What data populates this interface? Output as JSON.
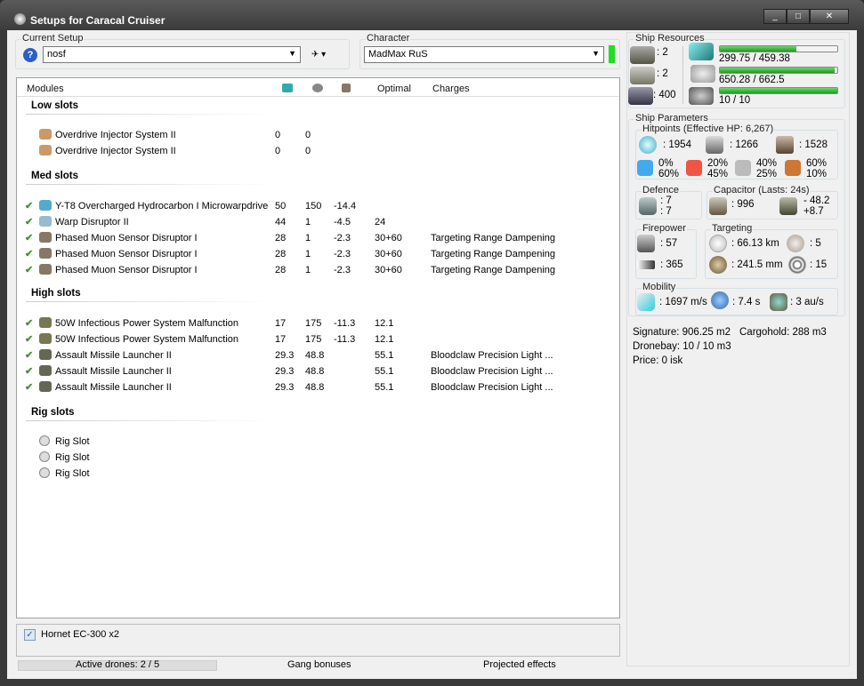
{
  "window": {
    "title": "Setups for Caracal Cruiser"
  },
  "current_setup": {
    "label": "Current Setup",
    "value": "nosf"
  },
  "character": {
    "label": "Character",
    "value": "MadMax RuS",
    "status_color": "#22dd22"
  },
  "table": {
    "headers": {
      "modules": "Modules",
      "optimal": "Optimal",
      "charges": "Charges"
    },
    "sections": [
      {
        "title": "Low slots",
        "rows": [
          {
            "name": "Overdrive Injector System II",
            "c1": "0",
            "c2": "0",
            "c3": "",
            "optimal": "",
            "charges": "",
            "active": false,
            "icon": "overdrive-icon"
          },
          {
            "name": "Overdrive Injector System II",
            "c1": "0",
            "c2": "0",
            "c3": "",
            "optimal": "",
            "charges": "",
            "active": false,
            "icon": "overdrive-icon"
          }
        ]
      },
      {
        "title": "Med slots",
        "rows": [
          {
            "name": "Y-T8 Overcharged Hydrocarbon I Microwarpdrive",
            "c1": "50",
            "c2": "150",
            "c3": "-14.4",
            "optimal": "",
            "charges": "",
            "active": true,
            "icon": "microwarpdrive-icon"
          },
          {
            "name": "Warp Disruptor II",
            "c1": "44",
            "c2": "1",
            "c3": "-4.5",
            "optimal": "24",
            "charges": "",
            "active": true,
            "icon": "warp-disruptor-icon"
          },
          {
            "name": "Phased Muon Sensor Disruptor I",
            "c1": "28",
            "c2": "1",
            "c3": "-2.3",
            "optimal": "30+60",
            "charges": "Targeting Range Dampening",
            "active": true,
            "icon": "sensor-disruptor-icon"
          },
          {
            "name": "Phased Muon Sensor Disruptor I",
            "c1": "28",
            "c2": "1",
            "c3": "-2.3",
            "optimal": "30+60",
            "charges": "Targeting Range Dampening",
            "active": true,
            "icon": "sensor-disruptor-icon"
          },
          {
            "name": "Phased Muon Sensor Disruptor I",
            "c1": "28",
            "c2": "1",
            "c3": "-2.3",
            "optimal": "30+60",
            "charges": "Targeting Range Dampening",
            "active": true,
            "icon": "sensor-disruptor-icon"
          }
        ]
      },
      {
        "title": "High slots",
        "rows": [
          {
            "name": "50W Infectious Power System Malfunction",
            "c1": "17",
            "c2": "175",
            "c3": "-11.3",
            "optimal": "12.1",
            "charges": "",
            "active": true,
            "icon": "energy-vampire-icon"
          },
          {
            "name": "50W Infectious Power System Malfunction",
            "c1": "17",
            "c2": "175",
            "c3": "-11.3",
            "optimal": "12.1",
            "charges": "",
            "active": true,
            "icon": "energy-vampire-icon"
          },
          {
            "name": "Assault Missile Launcher II",
            "c1": "29.3",
            "c2": "48.8",
            "c3": "",
            "optimal": "55.1",
            "charges": "Bloodclaw Precision Light ...",
            "active": true,
            "icon": "missile-launcher-icon"
          },
          {
            "name": "Assault Missile Launcher II",
            "c1": "29.3",
            "c2": "48.8",
            "c3": "",
            "optimal": "55.1",
            "charges": "Bloodclaw Precision Light ...",
            "active": true,
            "icon": "missile-launcher-icon"
          },
          {
            "name": "Assault Missile Launcher II",
            "c1": "29.3",
            "c2": "48.8",
            "c3": "",
            "optimal": "55.1",
            "charges": "Bloodclaw Precision Light ...",
            "active": true,
            "icon": "missile-launcher-icon"
          }
        ]
      },
      {
        "title": "Rig slots",
        "rows": [
          {
            "name": "Rig Slot",
            "c1": "",
            "c2": "",
            "c3": "",
            "optimal": "",
            "charges": "",
            "active": false,
            "icon": "empty-slot-icon"
          },
          {
            "name": "Rig Slot",
            "c1": "",
            "c2": "",
            "c3": "",
            "optimal": "",
            "charges": "",
            "active": false,
            "icon": "empty-slot-icon"
          },
          {
            "name": "Rig Slot",
            "c1": "",
            "c2": "",
            "c3": "",
            "optimal": "",
            "charges": "",
            "active": false,
            "icon": "empty-slot-icon"
          }
        ]
      }
    ]
  },
  "drones": {
    "item": "Hornet EC-300 x2",
    "checked": true
  },
  "status": {
    "active_drones": "Active drones: 2 / 5",
    "gang": "Gang bonuses",
    "projected": "Projected effects"
  },
  "resources": {
    "label": "Ship Resources",
    "turrets": ": 2",
    "launchers": ": 2",
    "calibration_total": ": 400",
    "powergrid": "299.75 / 459.38",
    "powergrid_frac": 0.65,
    "cpu": "650.28 / 662.5",
    "cpu_frac": 0.98,
    "calibration": "10 / 10",
    "calibration_frac": 1.0
  },
  "params": {
    "label": "Ship Parameters",
    "hitpoints": {
      "label": "Hitpoints (Effective HP: 6,267)",
      "shield": ": 1954",
      "armor": ": 1266",
      "hull": ": 1528",
      "resists": [
        [
          "0%",
          "60%"
        ],
        [
          "20%",
          "45%"
        ],
        [
          "40%",
          "25%"
        ],
        [
          "60%",
          "10%"
        ]
      ]
    },
    "defence": {
      "label": "Defence",
      "a": ": 7",
      "b": ": 7"
    },
    "capacitor": {
      "label": "Capacitor (Lasts: 24s)",
      "capacity": ": 996",
      "use": "- 48.2",
      "recharge": "+8.7"
    },
    "firepower": {
      "label": "Firepower",
      "a": ": 57",
      "b": ": 365"
    },
    "targeting": {
      "label": "Targeting",
      "range": ": 66.13 km",
      "targets": ": 5",
      "resolution": ": 241.5 mm",
      "scan": ": 15"
    },
    "mobility": {
      "label": "Mobility",
      "speed": ": 1697 m/s",
      "align": ": 7.4 s",
      "warp": ": 3 au/s"
    },
    "signature": "Signature: 906.25 m2",
    "cargo": "Cargohold: 288 m3",
    "dronebay": "Dronebay: 10 / 10 m3",
    "price": "Price: 0 isk"
  }
}
